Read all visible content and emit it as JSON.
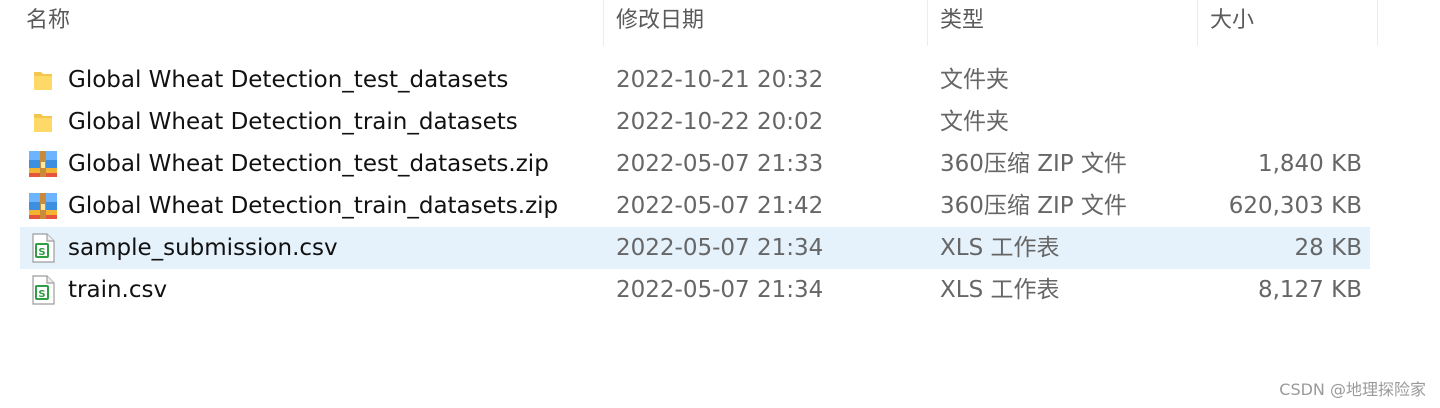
{
  "columns": {
    "name": "名称",
    "date": "修改日期",
    "type": "类型",
    "size": "大小"
  },
  "files": [
    {
      "name": "Global Wheat Detection_test_datasets",
      "date": "2022-10-21 20:32",
      "type": "文件夹",
      "size": "",
      "icon": "folder-icon",
      "selected": false
    },
    {
      "name": "Global Wheat Detection_train_datasets",
      "date": "2022-10-22 20:02",
      "type": "文件夹",
      "size": "",
      "icon": "folder-icon",
      "selected": false
    },
    {
      "name": "Global Wheat Detection_test_datasets.zip",
      "date": "2022-05-07 21:33",
      "type": "360压缩 ZIP 文件",
      "size": "1,840 KB",
      "icon": "zip-archive-icon",
      "selected": false
    },
    {
      "name": "Global Wheat Detection_train_datasets.zip",
      "date": "2022-05-07 21:42",
      "type": "360压缩 ZIP 文件",
      "size": "620,303 KB",
      "icon": "zip-archive-icon",
      "selected": false
    },
    {
      "name": "sample_submission.csv",
      "date": "2022-05-07 21:34",
      "type": "XLS 工作表",
      "size": "28 KB",
      "icon": "spreadsheet-icon",
      "selected": true
    },
    {
      "name": "train.csv",
      "date": "2022-05-07 21:34",
      "type": "XLS 工作表",
      "size": "8,127 KB",
      "icon": "spreadsheet-icon",
      "selected": false
    }
  ],
  "watermark": "CSDN @地理探险家",
  "colors": {
    "selection": "#e5f1fb",
    "folder": "#f4c64d",
    "spreadsheet": "#2f9e44"
  }
}
